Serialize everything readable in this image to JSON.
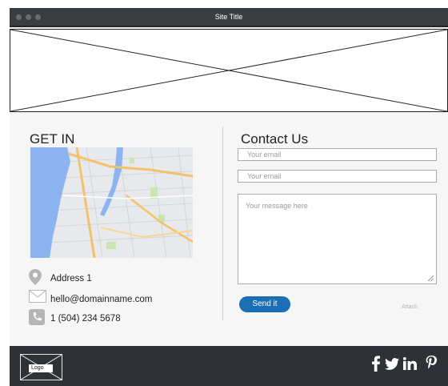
{
  "window": {
    "title": "Site Title"
  },
  "left": {
    "heading": "GET IN",
    "address": "Address 1",
    "email": "hello@domainname.com",
    "phone": "1 (504) 234 5678"
  },
  "right": {
    "heading": "Contact Us",
    "email1_placeholder": "Your email",
    "email2_placeholder": "Your email",
    "message_placeholder": "Your message here",
    "send_label": "Send it",
    "attach_label": "Attach"
  },
  "footer": {
    "logo_label": "Logo",
    "social_icons": [
      "facebook-icon",
      "twitter-icon",
      "linkedin-icon",
      "pinterest-icon"
    ]
  },
  "colors": {
    "titlebar": "#3a3d40",
    "footer": "#2e3136",
    "accent": "#1b6fb5",
    "map_water": "#8cb4f0"
  }
}
